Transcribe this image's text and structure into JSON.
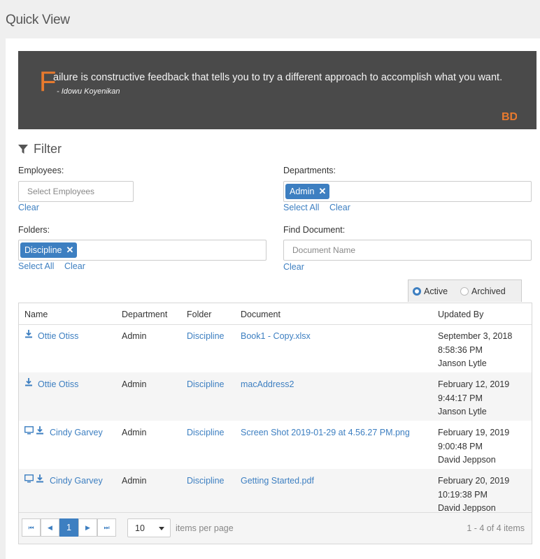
{
  "page": {
    "title": "Quick View"
  },
  "quote": {
    "initial": "F",
    "text": "ailure is constructive feedback that tells you to try a different approach to accomplish what you want.",
    "author": "- Idowu Koyenikan",
    "brand_accent": "#e87a2e",
    "logo_text": "BD"
  },
  "filter": {
    "heading": "Filter",
    "employees": {
      "label": "Employees:",
      "placeholder": "Select Employees",
      "clear": "Clear"
    },
    "departments": {
      "label": "Departments:",
      "tag": "Admin",
      "select_all": "Select All",
      "clear": "Clear"
    },
    "folders": {
      "label": "Folders:",
      "tag": "Discipline",
      "select_all": "Select All",
      "clear": "Clear"
    },
    "find_document": {
      "label": "Find Document:",
      "placeholder": "Document Name",
      "clear": "Clear"
    }
  },
  "status": {
    "options": [
      "Active",
      "Archived"
    ],
    "selected": "Active"
  },
  "grid": {
    "columns": [
      "Name",
      "Department",
      "Folder",
      "Document",
      "Updated By"
    ],
    "rows": [
      {
        "name": "Ottie Otiss",
        "department": "Admin",
        "folder": "Discipline",
        "document": "Book1 - Copy.xlsx",
        "updated_date": "September 3, 2018",
        "updated_time": "8:58:36 PM",
        "updated_by": "Janson Lytle",
        "monitor_icon": false
      },
      {
        "name": "Ottie Otiss",
        "department": "Admin",
        "folder": "Discipline",
        "document": "macAddress2",
        "updated_date": "February 12, 2019",
        "updated_time": "9:44:17 PM",
        "updated_by": "Janson Lytle",
        "monitor_icon": false
      },
      {
        "name": "Cindy Garvey",
        "department": "Admin",
        "folder": "Discipline",
        "document": "Screen Shot 2019-01-29 at 4.56.27 PM.png",
        "updated_date": "February 19, 2019",
        "updated_time": "9:00:48 PM",
        "updated_by": "David Jeppson",
        "monitor_icon": true
      },
      {
        "name": "Cindy Garvey",
        "department": "Admin",
        "folder": "Discipline",
        "document": "Getting Started.pdf",
        "updated_date": "February 20, 2019",
        "updated_time": "10:19:38 PM",
        "updated_by": "David Jeppson",
        "monitor_icon": true
      }
    ]
  },
  "pager": {
    "first_icon": "first-page-icon",
    "prev_icon": "prev-page-icon",
    "next_icon": "next-page-icon",
    "last_icon": "last-page-icon",
    "current_page": "1",
    "page_size": "10",
    "items_label": "items per page",
    "info": "1 - 4 of 4 items"
  },
  "colors": {
    "link": "#3d7fc1",
    "banner": "#4a4a4a",
    "accent": "#e87a2e"
  }
}
